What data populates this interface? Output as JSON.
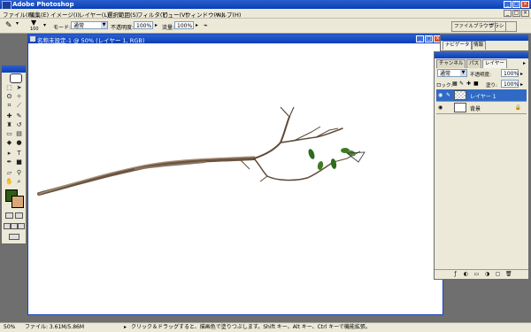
{
  "app": {
    "title": "Adobe Photoshop"
  },
  "menu": [
    "ファイル(F)",
    "編集(E)",
    "イメージ(I)",
    "レイヤー(L)",
    "選択範囲(S)",
    "フィルタ(T)",
    "ビュー(V)",
    "ウィンドウ(W)",
    "ヘルプ(H)"
  ],
  "options": {
    "brush_size": "100",
    "mode_label": "モード:",
    "mode_value": "通常",
    "opacity_label": "不透明度:",
    "opacity_value": "100%",
    "flow_label": "流量:",
    "flow_value": "100%"
  },
  "palette_well": {
    "tabs": [
      "ファイルブラウザ",
      "ブラシ"
    ]
  },
  "document": {
    "title": "名称未設定-1 @ 50% (レイヤー 1, RGB)"
  },
  "navigator": {
    "tabs": [
      "ナビゲータ",
      "情報"
    ]
  },
  "layers_palette": {
    "tabs": [
      "チャンネル",
      "パス",
      "レイヤー"
    ],
    "blend_mode": "通常",
    "opacity_label": "不透明度:",
    "opacity_value": "100%",
    "lock_label": "ロック:",
    "fill_label": "塗り:",
    "fill_value": "100%",
    "layers": [
      {
        "name": "レイヤー 1",
        "selected": true
      },
      {
        "name": "背景",
        "selected": false
      }
    ]
  },
  "toolbox": {
    "foreground_color": "#2f5a17",
    "background_color": "#d9a878"
  },
  "status": {
    "zoom": "50%",
    "file_info": "ファイル: 3.61M/5.86M",
    "hint": "クリック＆ドラッグすると、描画色で塗りつぶします。Shift キー、Alt キー、Ctrl キーで機能拡張。"
  }
}
